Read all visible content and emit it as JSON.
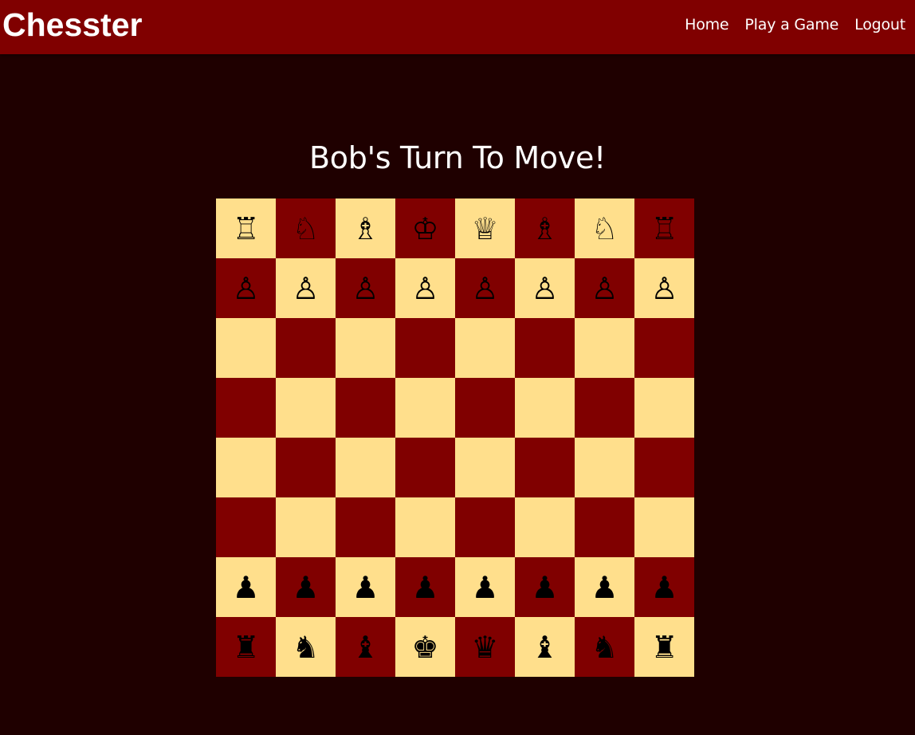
{
  "app": {
    "brand": "Chesster",
    "nav": [
      {
        "id": "home",
        "label": "Home"
      },
      {
        "id": "play",
        "label": "Play a Game"
      },
      {
        "id": "logout",
        "label": "Logout"
      }
    ]
  },
  "game": {
    "status": "Bob's Turn To Move!",
    "colors": {
      "light_square": "#ffdf8c",
      "dark_square": "#800000"
    },
    "ranks": [
      [
        {
          "icon": "white-rook-icon",
          "glyph": "♖"
        },
        {
          "icon": "white-knight-icon",
          "glyph": "♘"
        },
        {
          "icon": "white-bishop-icon",
          "glyph": "♗"
        },
        {
          "icon": "white-king-icon",
          "glyph": "♔"
        },
        {
          "icon": "white-queen-icon",
          "glyph": "♕"
        },
        {
          "icon": "white-bishop-icon",
          "glyph": "♗"
        },
        {
          "icon": "white-knight-icon",
          "glyph": "♘"
        },
        {
          "icon": "white-rook-icon",
          "glyph": "♖"
        }
      ],
      [
        {
          "icon": "white-pawn-icon",
          "glyph": "♙"
        },
        {
          "icon": "white-pawn-icon",
          "glyph": "♙"
        },
        {
          "icon": "white-pawn-icon",
          "glyph": "♙"
        },
        {
          "icon": "white-pawn-icon",
          "glyph": "♙"
        },
        {
          "icon": "white-pawn-icon",
          "glyph": "♙"
        },
        {
          "icon": "white-pawn-icon",
          "glyph": "♙"
        },
        {
          "icon": "white-pawn-icon",
          "glyph": "♙"
        },
        {
          "icon": "white-pawn-icon",
          "glyph": "♙"
        }
      ],
      [
        null,
        null,
        null,
        null,
        null,
        null,
        null,
        null
      ],
      [
        null,
        null,
        null,
        null,
        null,
        null,
        null,
        null
      ],
      [
        null,
        null,
        null,
        null,
        null,
        null,
        null,
        null
      ],
      [
        null,
        null,
        null,
        null,
        null,
        null,
        null,
        null
      ],
      [
        {
          "icon": "black-pawn-icon",
          "glyph": "♟"
        },
        {
          "icon": "black-pawn-icon",
          "glyph": "♟"
        },
        {
          "icon": "black-pawn-icon",
          "glyph": "♟"
        },
        {
          "icon": "black-pawn-icon",
          "glyph": "♟"
        },
        {
          "icon": "black-pawn-icon",
          "glyph": "♟"
        },
        {
          "icon": "black-pawn-icon",
          "glyph": "♟"
        },
        {
          "icon": "black-pawn-icon",
          "glyph": "♟"
        },
        {
          "icon": "black-pawn-icon",
          "glyph": "♟"
        }
      ],
      [
        {
          "icon": "black-rook-icon",
          "glyph": "♜"
        },
        {
          "icon": "black-knight-icon",
          "glyph": "♞"
        },
        {
          "icon": "black-bishop-icon",
          "glyph": "♝"
        },
        {
          "icon": "black-king-icon",
          "glyph": "♚"
        },
        {
          "icon": "black-queen-icon",
          "glyph": "♛"
        },
        {
          "icon": "black-bishop-icon",
          "glyph": "♝"
        },
        {
          "icon": "black-knight-icon",
          "glyph": "♞"
        },
        {
          "icon": "black-rook-icon",
          "glyph": "♜"
        }
      ]
    ]
  }
}
